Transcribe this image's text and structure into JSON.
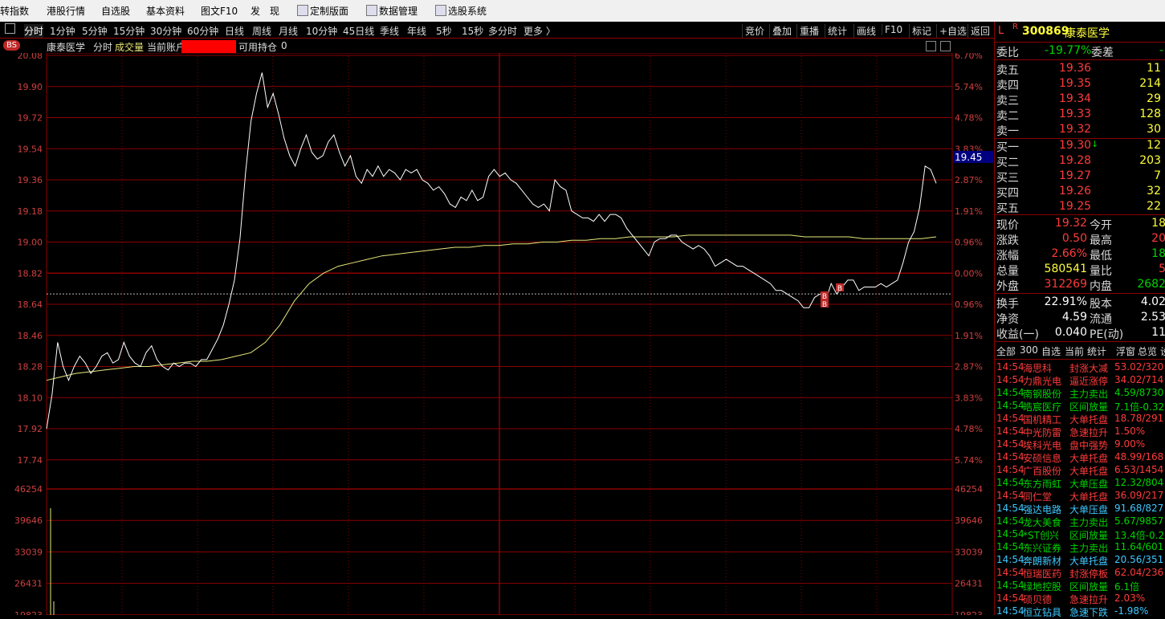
{
  "menubar": {
    "items": [
      "转指数",
      "港股行情",
      "自选股",
      "基本资料",
      "图文F10",
      "发　现",
      "定制版面",
      "数据管理",
      "选股系统"
    ]
  },
  "toolbar": {
    "periods": [
      "分时",
      "1分钟",
      "5分钟",
      "15分钟",
      "30分钟",
      "60分钟",
      "日线",
      "周线",
      "月线",
      "10分钟",
      "45日线",
      "季线",
      "年线",
      "5秒",
      "15秒",
      "多分时",
      "更多 〉"
    ],
    "right_buttons": [
      "竞价",
      "叠加",
      "重播",
      "统计",
      "画线",
      "F10",
      "标记",
      "+自选",
      "返回"
    ]
  },
  "infobar": {
    "badge": "BS",
    "name": "康泰医学",
    "mode": "分时",
    "volume_label": "成交量",
    "account_label": "当前账户",
    "position_label": "可用持仓",
    "position_value": "0"
  },
  "chart_data": {
    "type": "line",
    "price_axis": {
      "ticks": [
        "20.08",
        "19.90",
        "19.72",
        "19.54",
        "19.36",
        "19.18",
        "19.00",
        "18.82",
        "18.64",
        "18.46",
        "18.28",
        "18.10",
        "17.92",
        "17.74"
      ],
      "ylim": [
        17.74,
        20.08
      ]
    },
    "pct_axis": {
      "ticks": [
        "6.70%",
        "5.74%",
        "4.78%",
        "3.83%",
        "2.87%",
        "1.91%",
        "0.96%",
        "0.00%",
        "0.96%",
        "1.91%",
        "2.87%",
        "3.83%",
        "4.78%",
        "5.74%"
      ]
    },
    "prev_close": 18.82,
    "cursor_label": "19.45",
    "volume_axis": {
      "ticks": [
        "46254",
        "39646",
        "33039",
        "26431",
        "19823"
      ]
    },
    "series": [
      {
        "values": [
          17.92,
          18.12,
          18.42,
          18.28,
          18.2,
          18.28,
          18.34,
          18.3,
          18.24,
          18.28,
          18.34,
          18.36,
          18.3,
          18.32,
          18.42,
          18.34,
          18.3,
          18.28,
          18.36,
          18.4,
          18.32,
          18.28,
          18.26,
          18.3,
          18.28,
          18.3,
          18.3,
          18.28,
          18.32,
          18.32,
          18.38,
          18.44,
          18.52,
          18.64,
          18.78,
          19.02,
          19.4,
          19.7,
          19.86,
          19.98,
          19.78,
          19.86,
          19.74,
          19.6,
          19.5,
          19.44,
          19.54,
          19.62,
          19.52,
          19.48,
          19.5,
          19.58,
          19.62,
          19.52,
          19.44,
          19.5,
          19.38,
          19.34,
          19.42,
          19.38,
          19.44,
          19.38,
          19.42,
          19.4,
          19.36,
          19.42,
          19.4,
          19.42,
          19.36,
          19.34,
          19.3,
          19.32,
          19.28,
          19.22,
          19.2,
          19.26,
          19.24,
          19.3,
          19.24,
          19.26,
          19.38,
          19.42,
          19.38,
          19.4,
          19.36,
          19.34,
          19.3,
          19.26,
          19.22,
          19.2,
          19.22,
          19.18,
          19.36,
          19.32,
          19.3,
          19.18,
          19.16,
          19.14,
          19.14,
          19.12,
          19.16,
          19.12,
          19.16,
          19.16,
          19.14,
          19.08,
          19.04,
          19.0,
          18.96,
          18.92,
          19.0,
          19.02,
          19.02,
          19.04,
          19.04,
          19.0,
          18.98,
          18.96,
          18.98,
          18.96,
          18.92,
          18.86,
          18.88,
          18.9,
          18.88,
          18.86,
          18.86,
          18.84,
          18.82,
          18.8,
          18.78,
          18.76,
          18.72,
          18.72,
          18.7,
          18.68,
          18.66,
          18.62,
          18.62,
          18.68,
          18.7,
          18.66,
          18.76,
          18.7,
          18.74,
          18.78,
          18.78,
          18.72,
          18.74,
          18.74,
          18.74,
          18.76,
          18.74,
          18.76,
          18.78,
          18.88,
          19.0,
          19.06,
          19.2,
          19.44,
          19.42,
          19.34
        ]
      },
      {
        "values": [
          18.2,
          18.22,
          18.24,
          18.25,
          18.26,
          18.27,
          18.28,
          18.28,
          18.29,
          18.3,
          18.31,
          18.31,
          18.32,
          18.34,
          18.36,
          18.42,
          18.52,
          18.66,
          18.76,
          18.82,
          18.86,
          18.88,
          18.9,
          18.92,
          18.93,
          18.94,
          18.95,
          18.96,
          18.97,
          18.97,
          18.98,
          18.98,
          18.99,
          18.99,
          19.0,
          19.0,
          19.01,
          19.01,
          19.02,
          19.02,
          19.03,
          19.03,
          19.03,
          19.03,
          19.04,
          19.04,
          19.04,
          19.04,
          19.04,
          19.04,
          19.04,
          19.04,
          19.03,
          19.03,
          19.03,
          19.03,
          19.02,
          19.02,
          19.02,
          19.02,
          19.02,
          19.03
        ]
      }
    ],
    "markers": [
      "B",
      "B",
      "B"
    ]
  },
  "panel": {
    "stock": {
      "flag1": "L",
      "flag2": "R",
      "code": "300869",
      "name": "康泰医学"
    },
    "weibi": {
      "label": "委比",
      "value": "-19.77%",
      "label2": "委差",
      "value2": "-"
    },
    "asks": [
      {
        "label": "卖五",
        "price": "19.36",
        "vol": "11"
      },
      {
        "label": "卖四",
        "price": "19.35",
        "vol": "214"
      },
      {
        "label": "卖三",
        "price": "19.34",
        "vol": "29"
      },
      {
        "label": "卖二",
        "price": "19.33",
        "vol": "128"
      },
      {
        "label": "卖一",
        "price": "19.32",
        "vol": "30"
      }
    ],
    "bids": [
      {
        "label": "买一",
        "price": "19.30",
        "vol": "12",
        "arrow": "↓"
      },
      {
        "label": "买二",
        "price": "19.28",
        "vol": "203",
        "arrow": ""
      },
      {
        "label": "买三",
        "price": "19.27",
        "vol": "7",
        "arrow": ""
      },
      {
        "label": "买四",
        "price": "19.26",
        "vol": "32",
        "arrow": ""
      },
      {
        "label": "买五",
        "price": "19.25",
        "vol": "22",
        "arrow": ""
      }
    ],
    "quote": [
      {
        "l1": "现价",
        "v1": "19.32",
        "l2": "今开",
        "v2": "18"
      },
      {
        "l1": "涨跌",
        "v1": "0.50",
        "l2": "最高",
        "v2": "20"
      },
      {
        "l1": "涨幅",
        "v1": "2.66%",
        "l2": "最低",
        "v2": "18"
      },
      {
        "l1": "总量",
        "v1": "580541",
        "l2": "量比",
        "v2": "5"
      },
      {
        "l1": "外盘",
        "v1": "312269",
        "l2": "内盘",
        "v2": "2682"
      }
    ],
    "fund": [
      {
        "l1": "换手",
        "v1": "22.91%",
        "l2": "股本",
        "v2": "4.02"
      },
      {
        "l1": "净资",
        "v1": "4.59",
        "l2": "流通",
        "v2": "2.53"
      },
      {
        "l1": "收益(一)",
        "v1": "0.040",
        "l2": "PE(动)",
        "v2": "11"
      }
    ],
    "tabs": [
      "全部",
      "300",
      "自选",
      "当前",
      "统计",
      "浮窗",
      "总览",
      "设"
    ],
    "news": [
      {
        "time": "14:54",
        "name": "海思科",
        "event": "封涨大减",
        "val": "53.02/320"
      },
      {
        "time": "14:54",
        "name": "力鼎光电",
        "event": "逼近涨停",
        "val": "34.02/714"
      },
      {
        "time": "14:54",
        "name": "南钢股份",
        "event": "主力卖出",
        "val": "4.59/8730"
      },
      {
        "time": "14:54",
        "name": "皓宸医疗",
        "event": "区间放量",
        "val": "7.1倍-0.32"
      },
      {
        "time": "14:54",
        "name": "国机精工",
        "event": "大单托盘",
        "val": "18.78/291"
      },
      {
        "time": "14:54",
        "name": "中光防雷",
        "event": "急速拉升",
        "val": "1.50%"
      },
      {
        "time": "14:54",
        "name": "埃科光电",
        "event": "盘中强势",
        "val": "9.00%"
      },
      {
        "time": "14:54",
        "name": "安硕信息",
        "event": "大单托盘",
        "val": "48.99/168"
      },
      {
        "time": "14:54",
        "name": "广百股份",
        "event": "大单托盘",
        "val": "6.53/1454"
      },
      {
        "time": "14:54",
        "name": "东方雨虹",
        "event": "大单压盘",
        "val": "12.32/804"
      },
      {
        "time": "14:54",
        "name": "同仁堂",
        "event": "大单托盘",
        "val": "36.09/217"
      },
      {
        "time": "14:54",
        "name": "强达电路",
        "event": "大单压盘",
        "val": "91.68/827"
      },
      {
        "time": "14:54",
        "name": "龙大美食",
        "event": "主力卖出",
        "val": "5.67/9857"
      },
      {
        "time": "14:54",
        "name": "*ST创兴",
        "event": "区间放量",
        "val": "13.4倍-0.2"
      },
      {
        "time": "14:54",
        "name": "东兴证券",
        "event": "主力卖出",
        "val": "11.64/601"
      },
      {
        "time": "14:54",
        "name": "奔朗新材",
        "event": "大单托盘",
        "val": "20.56/351"
      },
      {
        "time": "14:54",
        "name": "恒瑞医药",
        "event": "封涨停板",
        "val": "62.04/236"
      },
      {
        "time": "14:54",
        "name": "绿地控股",
        "event": "区间放量",
        "val": "6.1倍"
      },
      {
        "time": "14:54",
        "name": "硕贝德",
        "event": "急速拉升",
        "val": "2.03%"
      },
      {
        "time": "14:54",
        "name": "恒立钻具",
        "event": "急速下跌",
        "val": "-1.98%"
      }
    ],
    "news_colors": [
      "red",
      "red",
      "grn",
      "grn",
      "red",
      "red",
      "red",
      "red",
      "red",
      "grn",
      "red",
      "cyan",
      "grn",
      "grn",
      "grn",
      "cyan",
      "red",
      "grn",
      "red",
      "cyan"
    ]
  }
}
